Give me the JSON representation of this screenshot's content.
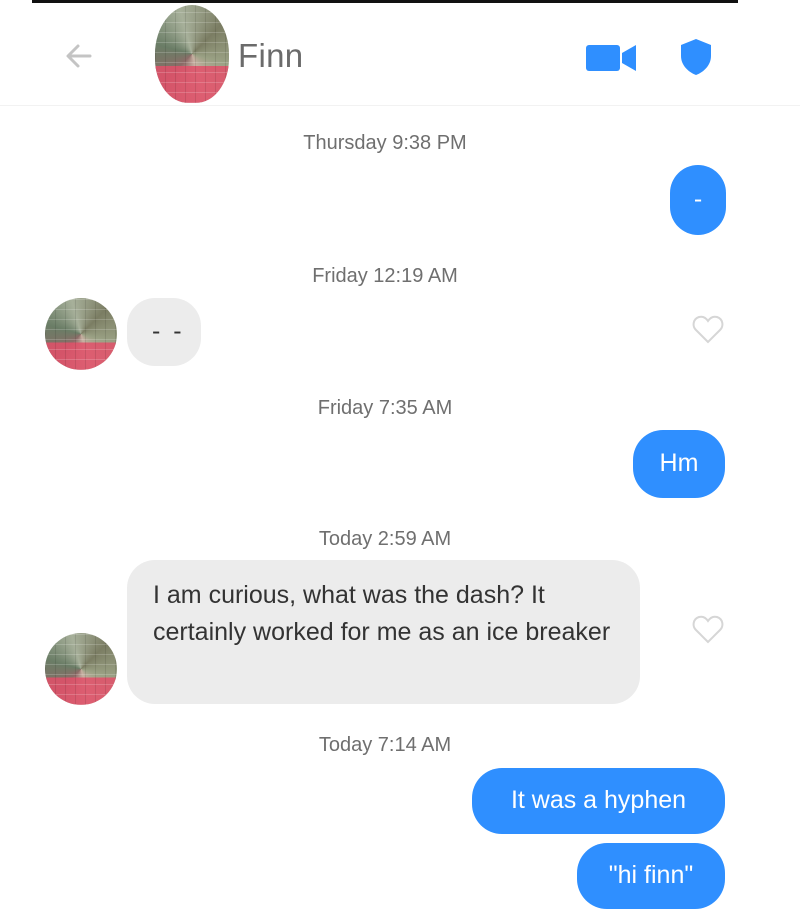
{
  "header": {
    "title": "Finn",
    "back_icon": "arrow-left-icon",
    "video_icon": "video-camera-icon",
    "safety_icon": "shield-icon",
    "accent": "#2f8fff"
  },
  "messages": [
    {
      "time": "Thursday 9:38 PM",
      "from": "me",
      "text": "-"
    },
    {
      "time": "Friday 12:19 AM",
      "from": "them",
      "text": "- -"
    },
    {
      "time": "Friday 7:35 AM",
      "from": "me",
      "text": "Hm"
    },
    {
      "time": "Today 2:59 AM",
      "from": "them",
      "text": "I am curious, what was the dash? It certainly worked for me as an ice breaker"
    },
    {
      "time": "Today 7:14 AM",
      "from": "me",
      "text": "It was a hyphen"
    },
    {
      "from": "me",
      "text": "\"hi finn\""
    }
  ],
  "colors": {
    "outgoing": "#2f8fff",
    "incoming": "#ececec",
    "timestamp": "#6f6f6f"
  }
}
